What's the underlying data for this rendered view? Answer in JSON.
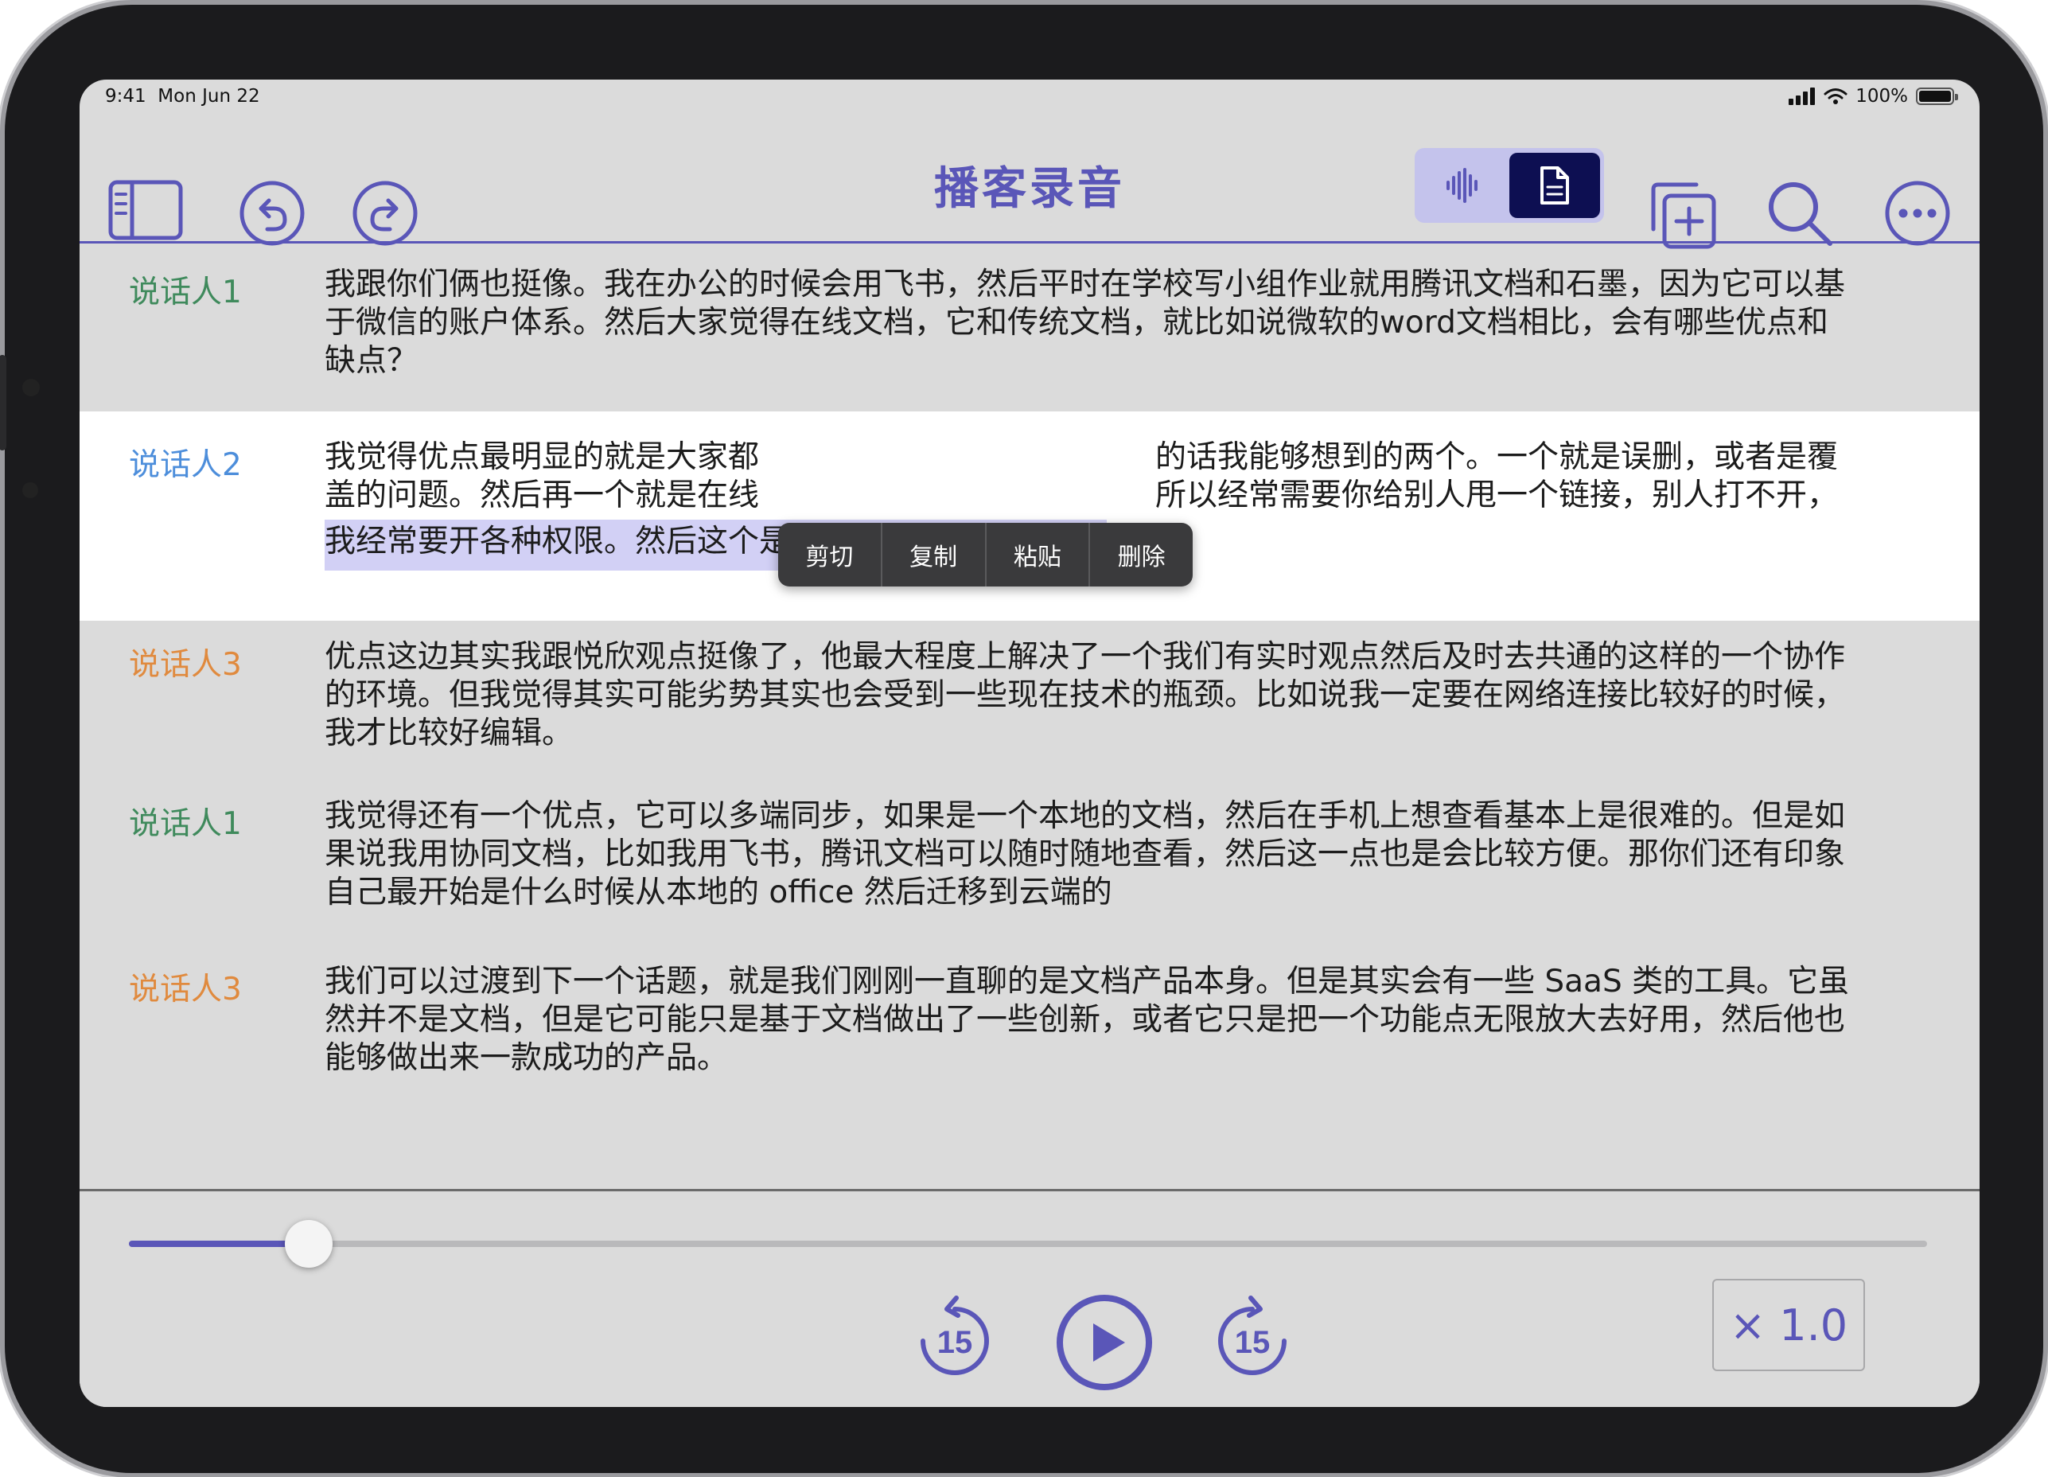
{
  "status_bar": {
    "time": "9:41",
    "date": "Mon Jun 22",
    "battery": "100%"
  },
  "toolbar": {
    "title": "播客录音",
    "icons": [
      "sidebar-icon",
      "undo-icon",
      "redo-icon",
      "waveform-icon",
      "document-icon",
      "add-copy-icon",
      "search-icon",
      "more-icon"
    ],
    "accent_color": "#5a56b8",
    "segment_selected": "document"
  },
  "context_menu": {
    "items": [
      "剪切",
      "复制",
      "粘贴",
      "删除"
    ]
  },
  "transcript": [
    {
      "speaker": "说话人1",
      "color": "#3f8a5c",
      "lines": [
        "我跟你们俩也挺像。我在办公的时候会用飞书，然后平时在学校写小组作业就用腾讯文档和石墨，因为它可以基",
        "于微信的账户体系。然后大家觉得在线文档，它和传统文档，就比如说微软的word文档相比，会有哪些优点和",
        "缺点？"
      ]
    },
    {
      "speaker": "说话人2",
      "color": "#4d8edb",
      "lines": [
        "我觉得优点最明显的就是大家都",
        "的话我能够想到的两个。一个就是误删，或者是覆",
        "盖的问题。然后再一个就是在线",
        "所以经常需要你给别人甩一个链接，别人打不开，",
        "我经常要开各种权限。然后这个是我能想到的两个劣势。"
      ]
    },
    {
      "speaker": "说话人3",
      "color": "#e08a3e",
      "lines": [
        "优点这边其实我跟悦欣观点挺像了，他最大程度上解决了一个我们有实时观点然后及时去共通的这样的一个协作",
        "的环境。但我觉得其实可能劣势其实也会受到一些现在技术的瓶颈。比如说我一定要在网络连接比较好的时候，",
        "我才比较好编辑。"
      ]
    },
    {
      "speaker": "说话人1",
      "color": "#3f8a5c",
      "lines": [
        "我觉得还有一个优点，它可以多端同步，如果是一个本地的文档，然后在手机上想查看基本上是很难的。但是如",
        "果说我用协同文档，比如我用飞书，腾讯文档可以随时随地查看，然后这一点也是会比较方便。那你们还有印象",
        "自己最开始是什么时候从本地的 office 然后迁移到云端的"
      ]
    },
    {
      "speaker": "说话人3",
      "color": "#e08a3e",
      "lines": [
        "我们可以过渡到下一个话题，就是我们刚刚一直聊的是文档产品本身。但是其实会有一些 SaaS 类的工具。它虽",
        "然并不是文档，但是它可能只是基于文档做出了一些创新，或者它只是把一个功能点无限放大去好用，然后他也",
        "能够做出来一款成功的产品。"
      ]
    }
  ],
  "player": {
    "progress": 0.1,
    "skip_back_label": "15",
    "skip_forward_label": "15",
    "speed": "× 1.0"
  }
}
